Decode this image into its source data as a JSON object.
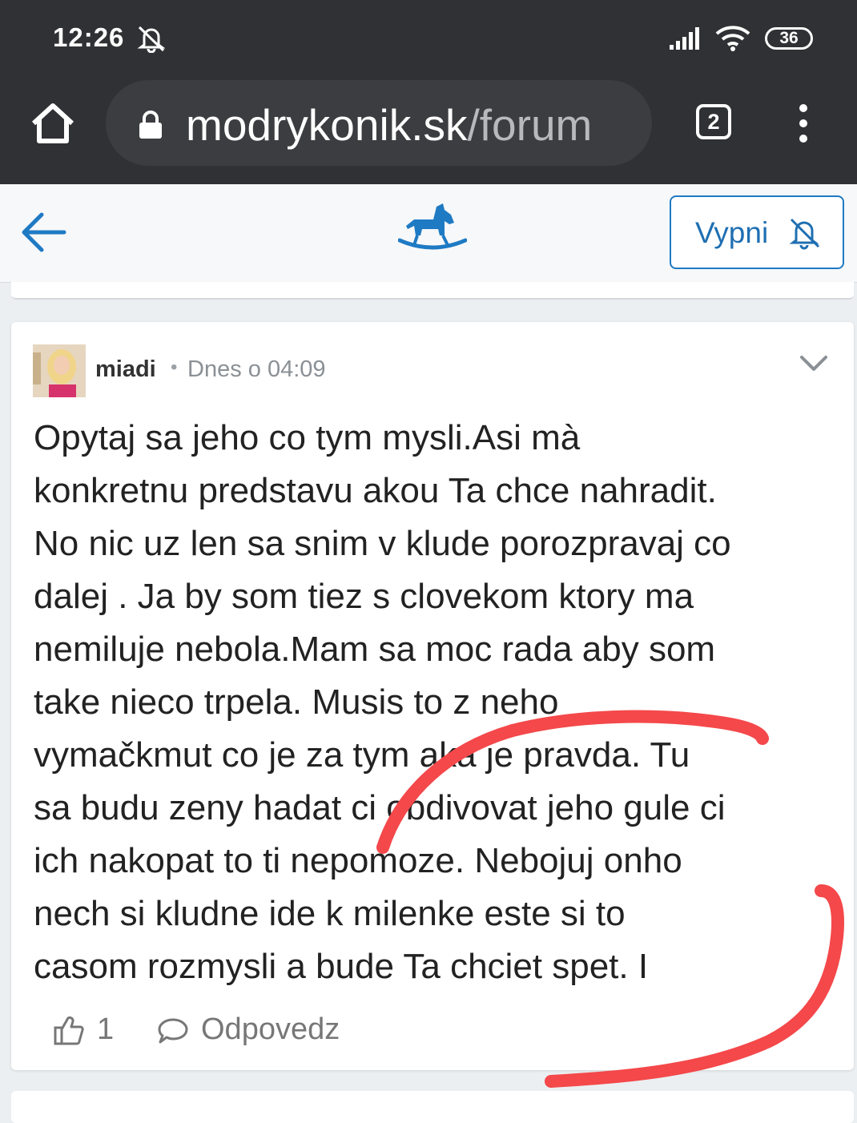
{
  "status_bar": {
    "time": "12:26",
    "battery": "36",
    "icons": [
      "bell-off-icon",
      "signal-icon",
      "wifi-icon",
      "battery-icon"
    ]
  },
  "browser": {
    "url_domain": "modrykonik.sk",
    "url_path": "/forum",
    "tab_count": "2",
    "icons": [
      "home-icon",
      "lock-icon",
      "tabs-icon",
      "kebab-menu-icon"
    ]
  },
  "site_header": {
    "notifications_button_label": "Vypni",
    "icons": [
      "back-arrow-icon",
      "rocking-horse-logo-icon",
      "bell-off-icon"
    ]
  },
  "post": {
    "author": "miadi",
    "separator": "•",
    "timestamp": "Dnes o 04:09",
    "body": "Opytaj sa jeho co tym mysli.Asi mà\nkonkretnu predstavu akou Ta chce nahradit.\nNo nic uz len sa snim v klude porozpravaj co\ndalej . Ja by som tiez s clovekom ktory ma\nnemiluje nebola.Mam sa moc rada aby som\ntake nieco trpela. Musis to z neho\nvymačkmut co je za tym aka je pravda. Tu\nsa budu zeny hadat ci obdivovat jeho gule ci\nich nakopat to ti nepomoze. Nebojuj onho\nnech si kludne ide k milenke este si to\ncasom rozmysli a bude Ta chciet spet. I",
    "like_count": "1",
    "reply_label": "Odpovedz",
    "icons": [
      "avatar",
      "chevron-down-icon",
      "thumbs-up-icon",
      "comment-icon"
    ]
  },
  "colors": {
    "browser_chrome": "#303134",
    "accent_blue": "#1f7ac4",
    "scribble_red": "#f4484a"
  }
}
